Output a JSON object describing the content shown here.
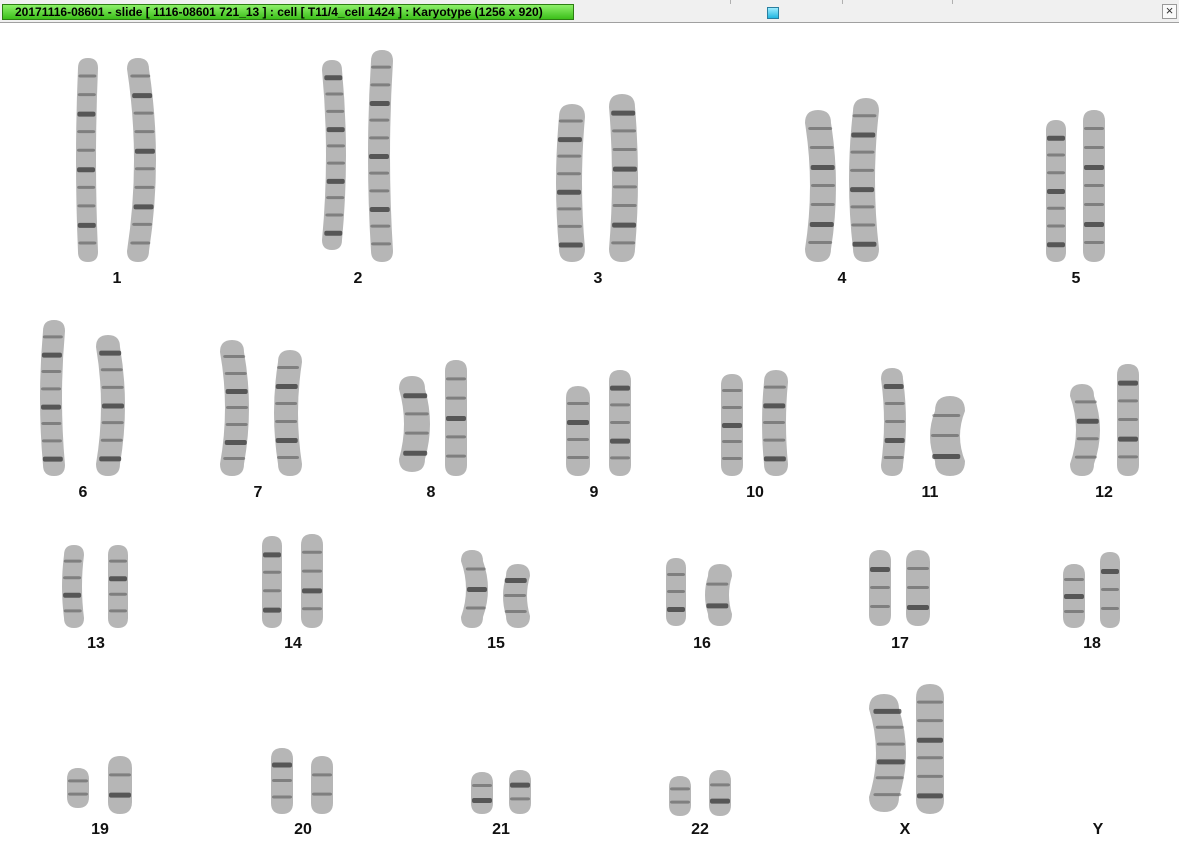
{
  "window": {
    "title": "20171116-08601 - slide [ 1116-08601 721_13 ] : cell [ T11/4_cell 1424 ] : Karyotype  (1256 x 920)",
    "close_label": "×"
  },
  "karyotype": {
    "pairs": [
      {
        "label": "1"
      },
      {
        "label": "2"
      },
      {
        "label": "3"
      },
      {
        "label": "4"
      },
      {
        "label": "5"
      },
      {
        "label": "6"
      },
      {
        "label": "7"
      },
      {
        "label": "8"
      },
      {
        "label": "9"
      },
      {
        "label": "10"
      },
      {
        "label": "11"
      },
      {
        "label": "12"
      },
      {
        "label": "13"
      },
      {
        "label": "14"
      },
      {
        "label": "15"
      },
      {
        "label": "16"
      },
      {
        "label": "17"
      },
      {
        "label": "18"
      },
      {
        "label": "19"
      },
      {
        "label": "20"
      },
      {
        "label": "21"
      },
      {
        "label": "22"
      },
      {
        "label": "X"
      },
      {
        "label": "Y"
      }
    ]
  },
  "colors": {
    "chromosome": "#7a7a7a",
    "band_dark": "#2e2e2e",
    "title_bar": "#5fd83a"
  }
}
